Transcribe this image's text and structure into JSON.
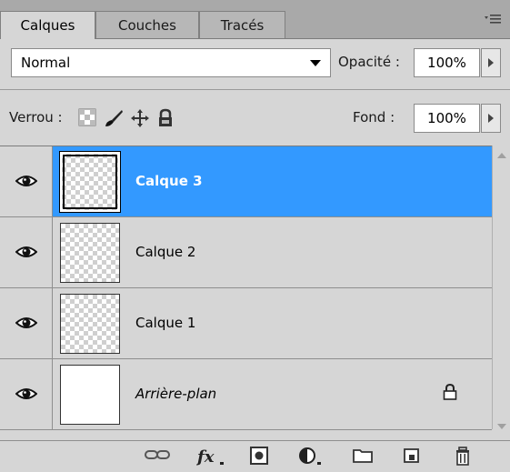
{
  "tabs": [
    {
      "label": "Calques",
      "active": true
    },
    {
      "label": "Couches",
      "active": false
    },
    {
      "label": "Tracés",
      "active": false
    }
  ],
  "panel_menu_icon": "panel-menu-icon",
  "blend_mode": {
    "value": "Normal"
  },
  "opacity": {
    "label": "Opacité :",
    "value": "100%"
  },
  "lock": {
    "label": "Verrou :",
    "icons": [
      "lock-transparent-icon",
      "lock-image-brush-icon",
      "lock-position-move-icon",
      "lock-all-padlock-icon"
    ]
  },
  "fill": {
    "label": "Fond :",
    "value": "100%"
  },
  "layers": [
    {
      "name": "Calque 3",
      "selected": true,
      "visible": true,
      "transparent": true
    },
    {
      "name": "Calque 2",
      "selected": false,
      "visible": true,
      "transparent": true
    },
    {
      "name": "Calque 1",
      "selected": false,
      "visible": true,
      "transparent": true
    },
    {
      "name": "Arrière-plan",
      "selected": false,
      "visible": true,
      "transparent": false,
      "locked": true,
      "italic": true
    }
  ],
  "bottom_icons": [
    "link-layers-icon",
    "fx-icon",
    "layer-mask-icon",
    "adjustment-layer-icon",
    "new-group-folder-icon",
    "new-layer-icon",
    "trash-icon"
  ],
  "colors": {
    "selection": "#3399ff",
    "panel": "#d6d6d6",
    "tabbar": "#a9a9a9"
  }
}
